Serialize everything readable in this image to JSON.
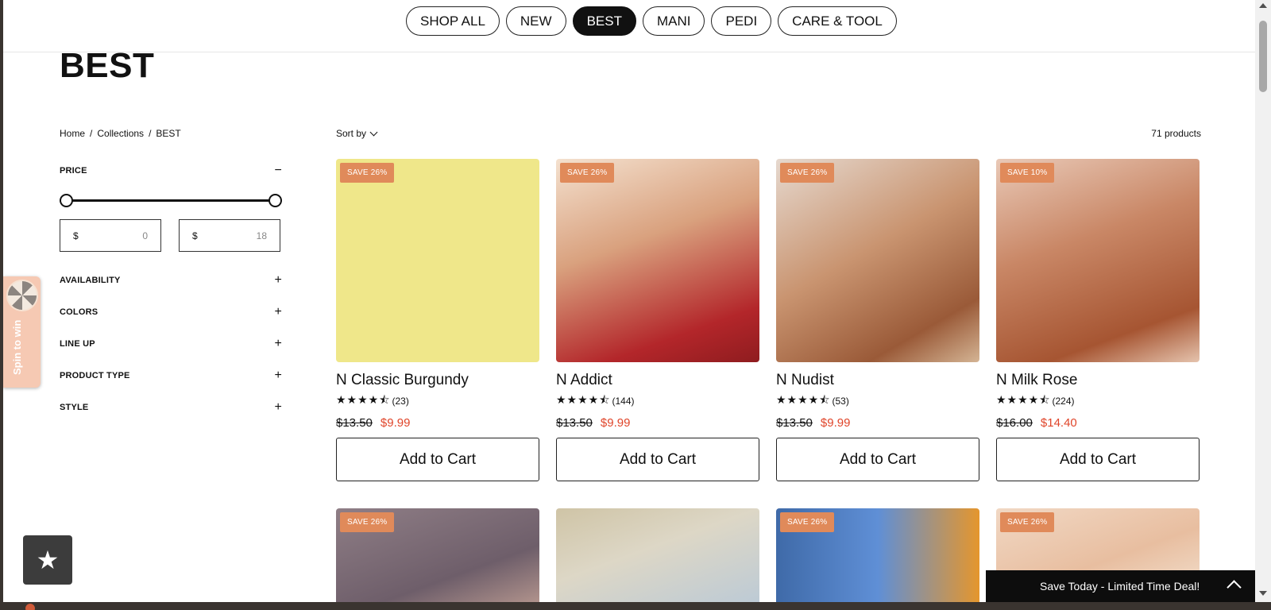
{
  "nav": {
    "pills": [
      {
        "label": "SHOP ALL"
      },
      {
        "label": "NEW"
      },
      {
        "label": "BEST"
      },
      {
        "label": "MANI"
      },
      {
        "label": "PEDI"
      },
      {
        "label": "CARE & TOOL"
      }
    ],
    "active": "BEST"
  },
  "page": {
    "title": "BEST"
  },
  "breadcrumb": {
    "home": "Home",
    "collections": "Collections",
    "current": "BEST",
    "sep": "/"
  },
  "filters": {
    "price": {
      "label": "PRICE",
      "toggle": "−",
      "min_prefix": "$",
      "max_prefix": "$",
      "min_value": "0",
      "max_value": "18"
    },
    "groups": [
      {
        "label": "AVAILABILITY",
        "toggle": "+"
      },
      {
        "label": "COLORS",
        "toggle": "+"
      },
      {
        "label": "LINE UP",
        "toggle": "+"
      },
      {
        "label": "PRODUCT TYPE",
        "toggle": "+"
      },
      {
        "label": "STYLE",
        "toggle": "+"
      }
    ]
  },
  "sort": {
    "label": "Sort by"
  },
  "count": {
    "text": "71 products"
  },
  "products": [
    {
      "badge": "SAVE 26%",
      "name": "N Classic Burgundy",
      "stars": "★★★★⯪",
      "reviews": "(23)",
      "old_price": "$13.50",
      "new_price": "$9.99",
      "cta": "Add to Cart"
    },
    {
      "badge": "SAVE 26%",
      "name": "N Addict",
      "stars": "★★★★⯪",
      "reviews": "(144)",
      "old_price": "$13.50",
      "new_price": "$9.99",
      "cta": "Add to Cart"
    },
    {
      "badge": "SAVE 26%",
      "name": "N Nudist",
      "stars": "★★★★⯪",
      "reviews": "(53)",
      "old_price": "$13.50",
      "new_price": "$9.99",
      "cta": "Add to Cart"
    },
    {
      "badge": "SAVE 10%",
      "name": "N Milk Rose",
      "stars": "★★★★⯪",
      "reviews": "(224)",
      "old_price": "$16.00",
      "new_price": "$14.40",
      "cta": "Add to Cart"
    }
  ],
  "products_row2": [
    {
      "badge": "SAVE 26%"
    },
    {
      "badge": ""
    },
    {
      "badge": "SAVE 26%"
    },
    {
      "badge": "SAVE 26%"
    }
  ],
  "spin": {
    "label": "Spin to win"
  },
  "reviews_button": {
    "icon": "star-icon"
  },
  "deal_bar": {
    "text": "Save Today - Limited Time Deal!"
  },
  "colors": {
    "accent_sale": "#e0452a",
    "badge": "#e08a5a",
    "active_pill": "#111111"
  }
}
